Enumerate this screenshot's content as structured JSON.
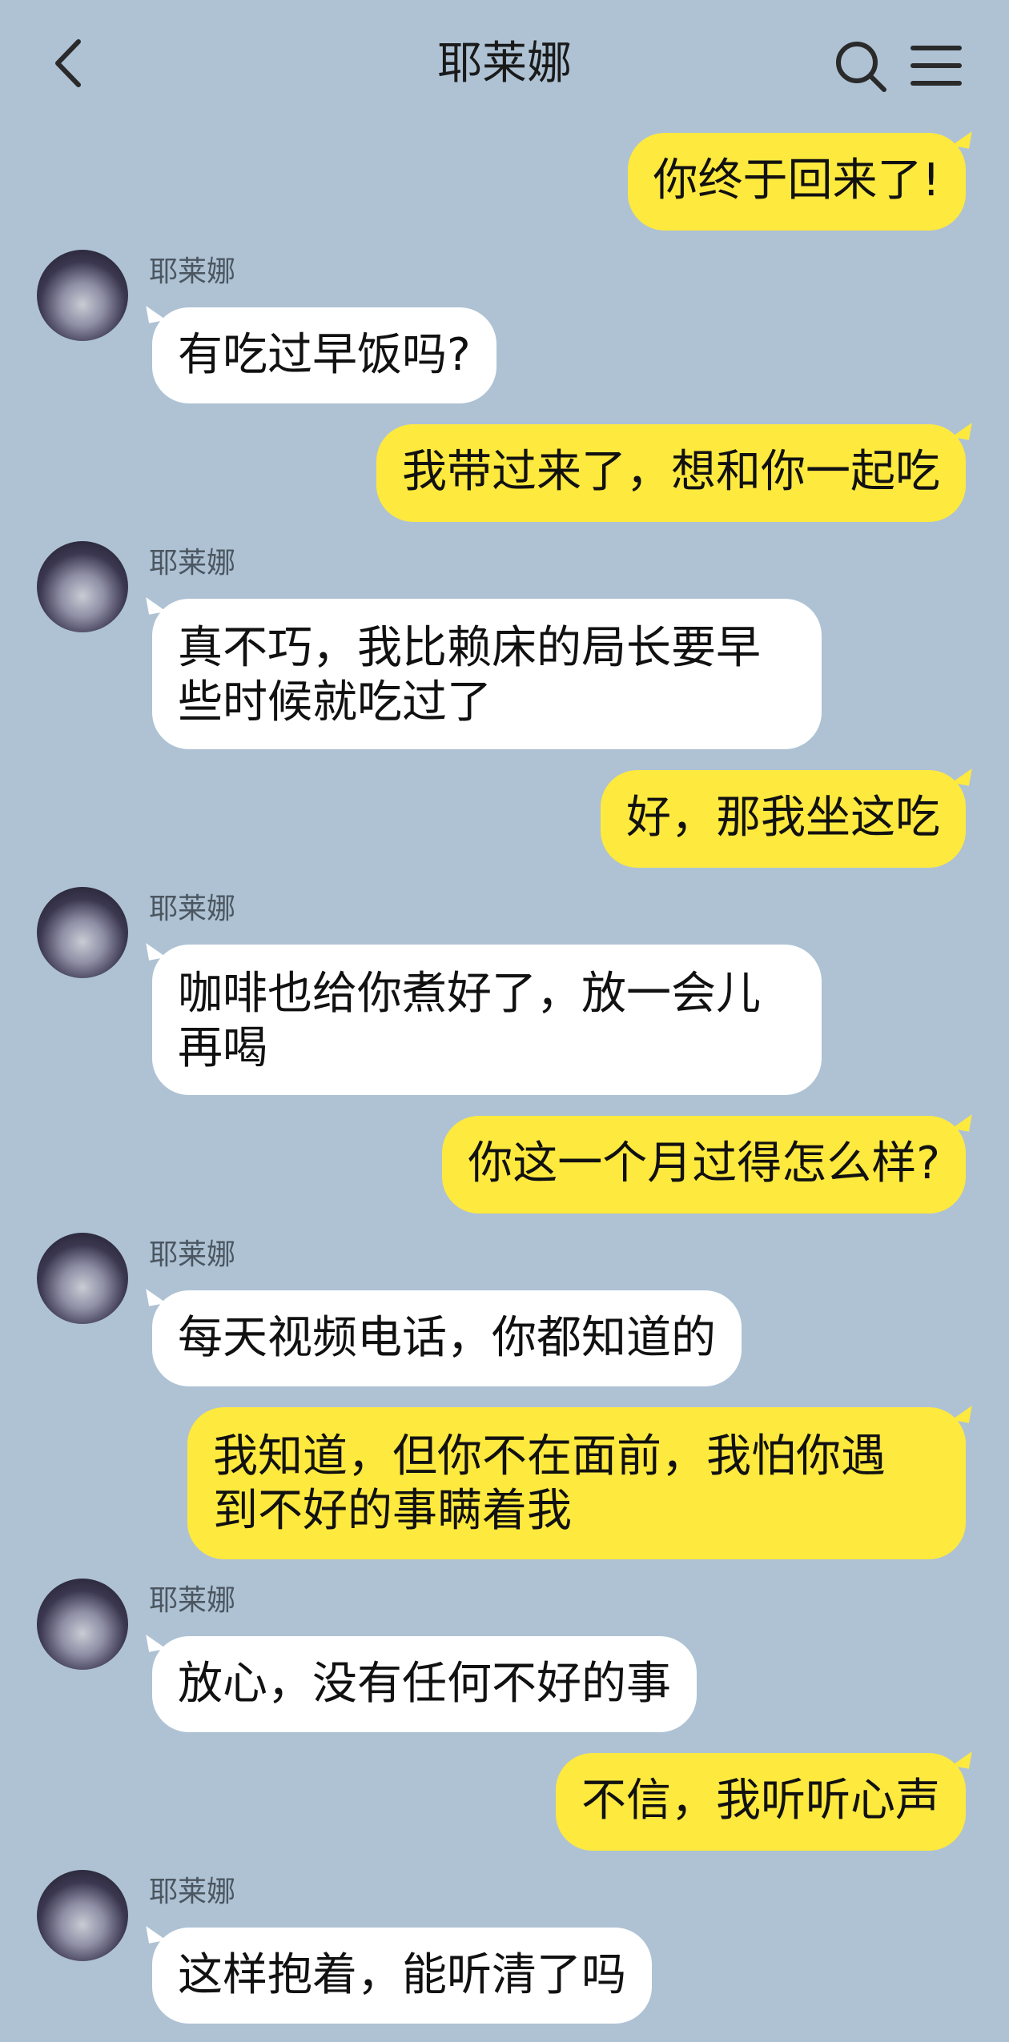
{
  "header": {
    "title": "耶莱娜"
  },
  "messages": [
    {
      "from": "me",
      "text": "你终于回来了!"
    },
    {
      "from": "them",
      "sender": "耶莱娜",
      "text": "有吃过早饭吗?"
    },
    {
      "from": "me",
      "text": "我带过来了，想和你一起吃"
    },
    {
      "from": "them",
      "sender": "耶莱娜",
      "lines": [
        "真不巧，我比赖床的局长要早",
        "些时候就吃过了"
      ]
    },
    {
      "from": "me",
      "text": "好，那我坐这吃"
    },
    {
      "from": "them",
      "sender": "耶莱娜",
      "lines": [
        "咖啡也给你煮好了，放一会儿",
        "再喝"
      ]
    },
    {
      "from": "me",
      "text": "你这一个月过得怎么样?"
    },
    {
      "from": "them",
      "sender": "耶莱娜",
      "text": "每天视频电话，你都知道的"
    },
    {
      "from": "me",
      "lines": [
        "我知道，但你不在面前，我怕你遇",
        "到不好的事瞒着我"
      ]
    },
    {
      "from": "them",
      "sender": "耶莱娜",
      "text": "放心，没有任何不好的事"
    },
    {
      "from": "me",
      "text": "不信，我听听心声"
    },
    {
      "from": "them",
      "sender": "耶莱娜",
      "text": "这样抱着，能听清了吗"
    }
  ],
  "colors": {
    "background": "#aec2d4",
    "my_bubble": "#fee93e",
    "their_bubble": "#ffffff"
  },
  "icons": {
    "back": "chevron-left-icon",
    "search": "search-icon",
    "menu": "hamburger-menu-icon"
  }
}
